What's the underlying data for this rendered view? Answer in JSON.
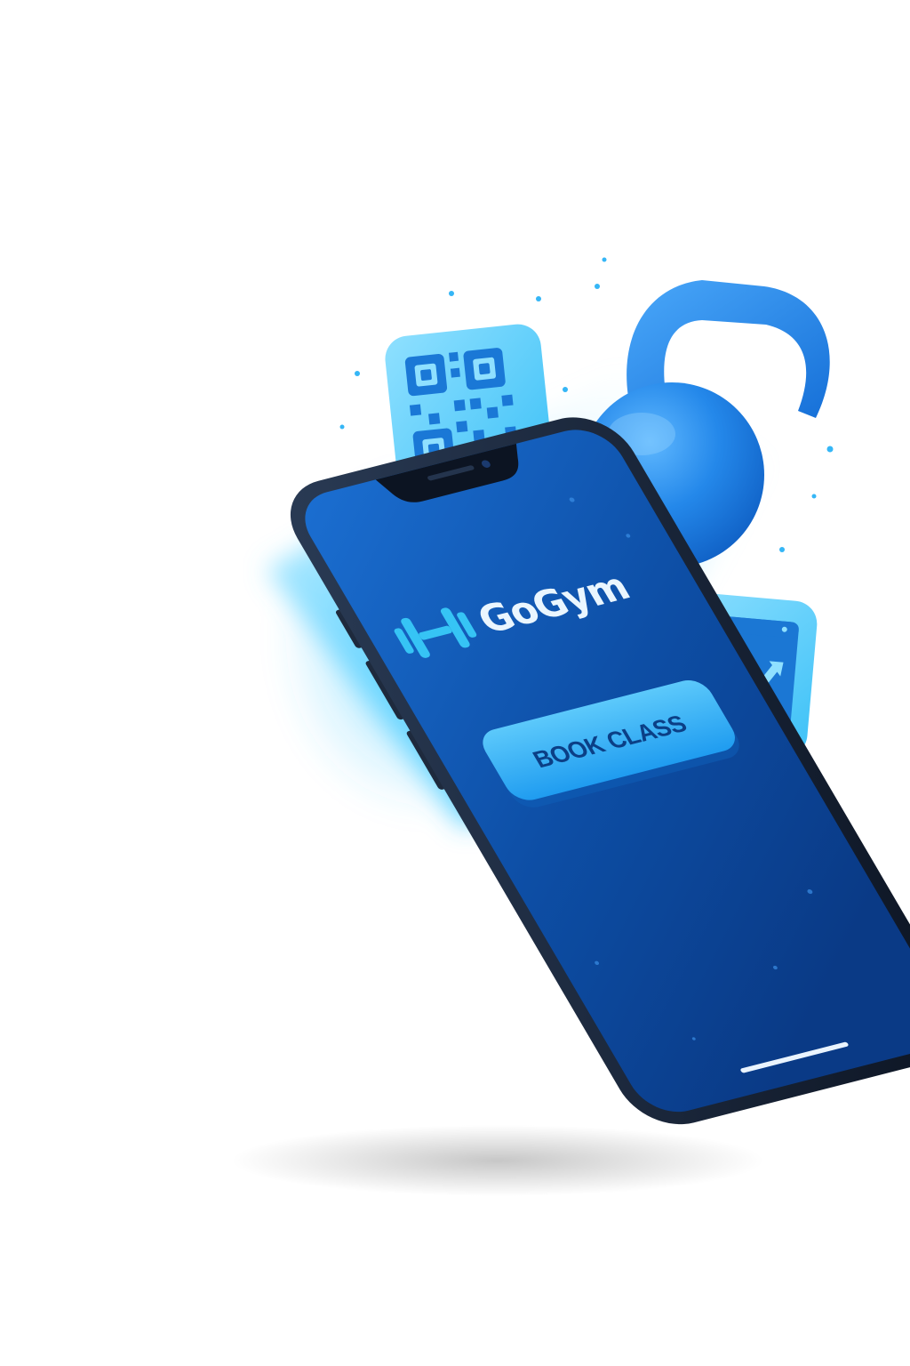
{
  "app": {
    "brand_name": "GoGym",
    "brand_icon": "dumbbell-icon"
  },
  "screen": {
    "primary_button_label": "BOOK CLASS"
  },
  "floating_icons": [
    {
      "name": "qr-code-icon"
    },
    {
      "name": "kettlebell-icon"
    },
    {
      "name": "progress-chart-icon"
    }
  ],
  "colors": {
    "screen_dark": "#0a3a86",
    "screen_light": "#1b6fd2",
    "accent": "#1fa2f5",
    "button": "#2fb2f7",
    "button_text": "#0b3f86",
    "phone_frame": "#0f1a2b"
  }
}
